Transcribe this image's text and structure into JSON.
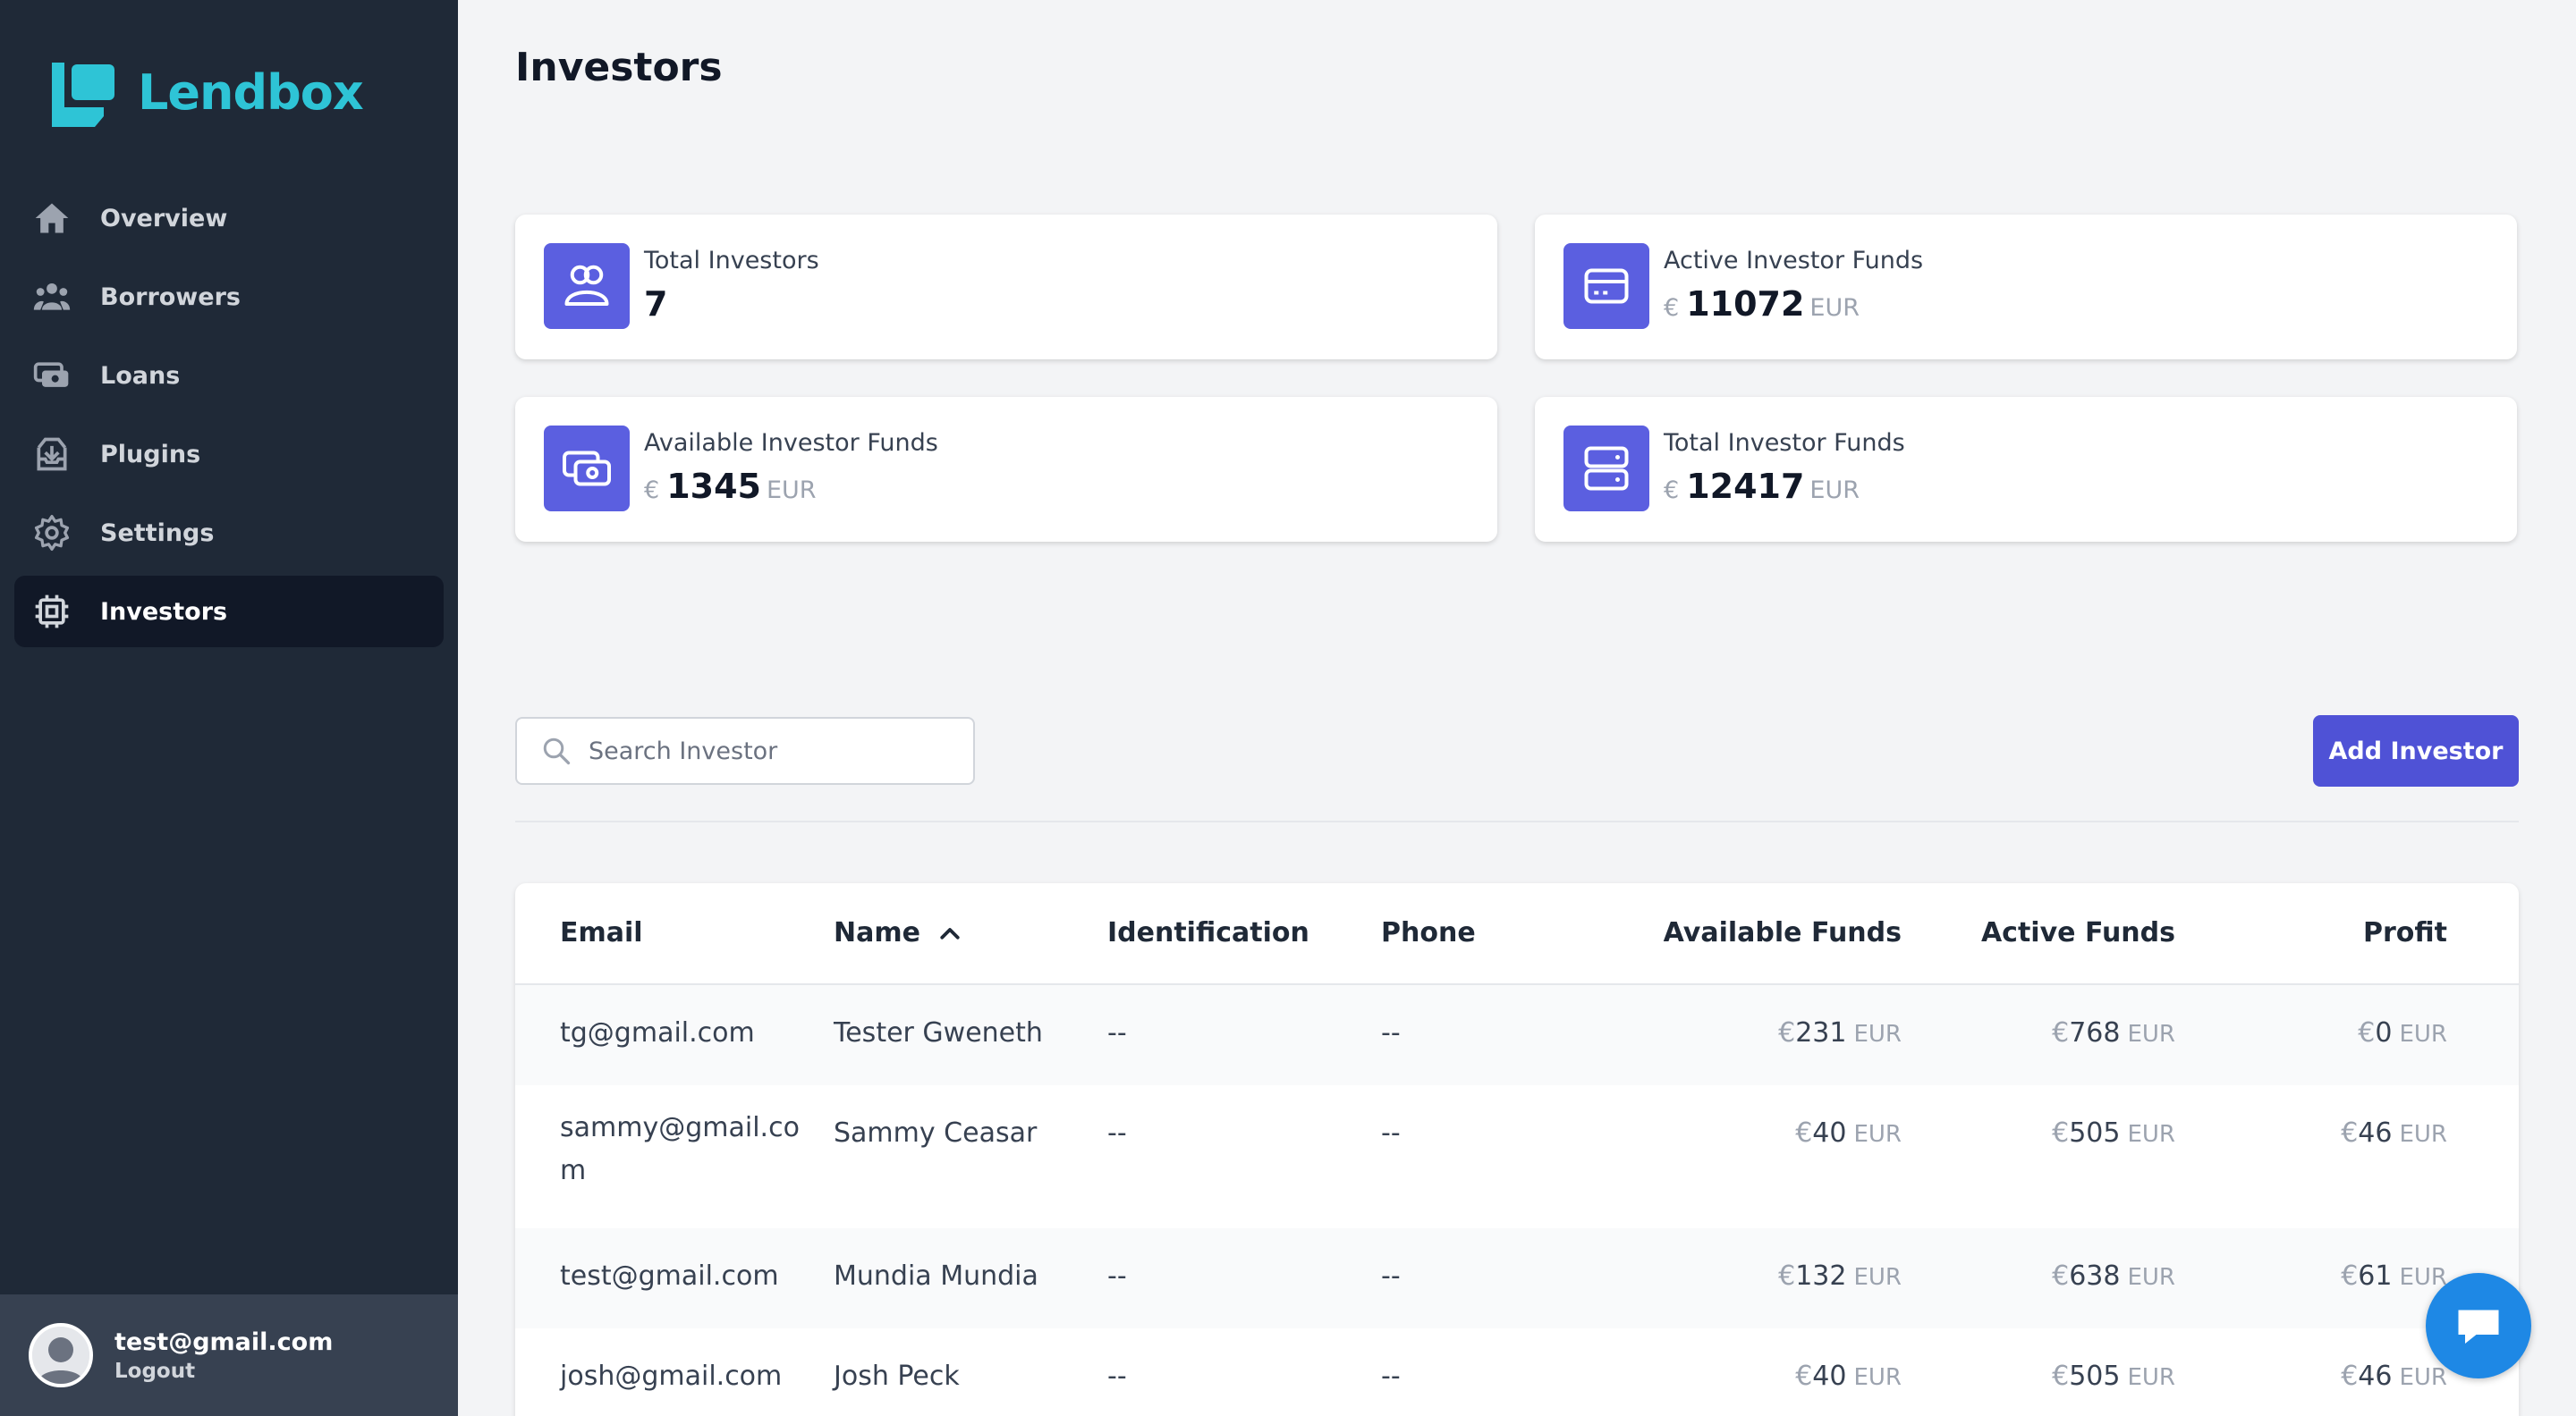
{
  "brand": {
    "name": "Lendbox",
    "accent": "#2ec4d6"
  },
  "sidebar": {
    "items": [
      {
        "label": "Overview",
        "icon": "home-icon"
      },
      {
        "label": "Borrowers",
        "icon": "users-icon"
      },
      {
        "label": "Loans",
        "icon": "money-icon"
      },
      {
        "label": "Plugins",
        "icon": "download-icon"
      },
      {
        "label": "Settings",
        "icon": "gear-icon"
      },
      {
        "label": "Investors",
        "icon": "chip-icon",
        "active": true
      }
    ],
    "user": {
      "email": "test@gmail.com",
      "logout": "Logout"
    }
  },
  "page": {
    "title": "Investors"
  },
  "stats": [
    {
      "label": "Total Investors",
      "value": "7",
      "icon": "users-icon"
    },
    {
      "label": "Active Investor Funds",
      "currency": "€",
      "value": "11072",
      "unit": "EUR",
      "icon": "credit-card-icon"
    },
    {
      "label": "Available Investor Funds",
      "currency": "€",
      "value": "1345",
      "unit": "EUR",
      "icon": "cash-icon"
    },
    {
      "label": "Total Investor Funds",
      "currency": "€",
      "value": "12417",
      "unit": "EUR",
      "icon": "server-icon"
    }
  ],
  "toolbar": {
    "search_placeholder": "Search Investor",
    "add_label": "Add Investor"
  },
  "table": {
    "columns": [
      "Email",
      "Name",
      "Identification",
      "Phone",
      "Available Funds",
      "Active Funds",
      "Profit"
    ],
    "sorted_column": "Name",
    "sort_direction": "ascending",
    "rows": [
      {
        "email": "tg@gmail.com",
        "name": "Tester Gweneth",
        "identification": "--",
        "phone": "--",
        "available": "231",
        "active": "768",
        "profit": "0"
      },
      {
        "email": "sammy@gmail.com",
        "name": "Sammy Ceasar",
        "identification": "--",
        "phone": "--",
        "available": "40",
        "active": "505",
        "profit": "46"
      },
      {
        "email": "test@gmail.com",
        "name": "Mundia Mundia",
        "identification": "--",
        "phone": "--",
        "available": "132",
        "active": "638",
        "profit": "61"
      },
      {
        "email": "josh@gmail.com",
        "name": "Josh Peck",
        "identification": "--",
        "phone": "--",
        "available": "40",
        "active": "505",
        "profit": "46"
      }
    ],
    "currency": "€",
    "unit": "EUR"
  },
  "colors": {
    "sidebar": "#1f2937",
    "primary": "#4f52d6",
    "tile": "#5b5fe0",
    "chat": "#1e88e5"
  }
}
